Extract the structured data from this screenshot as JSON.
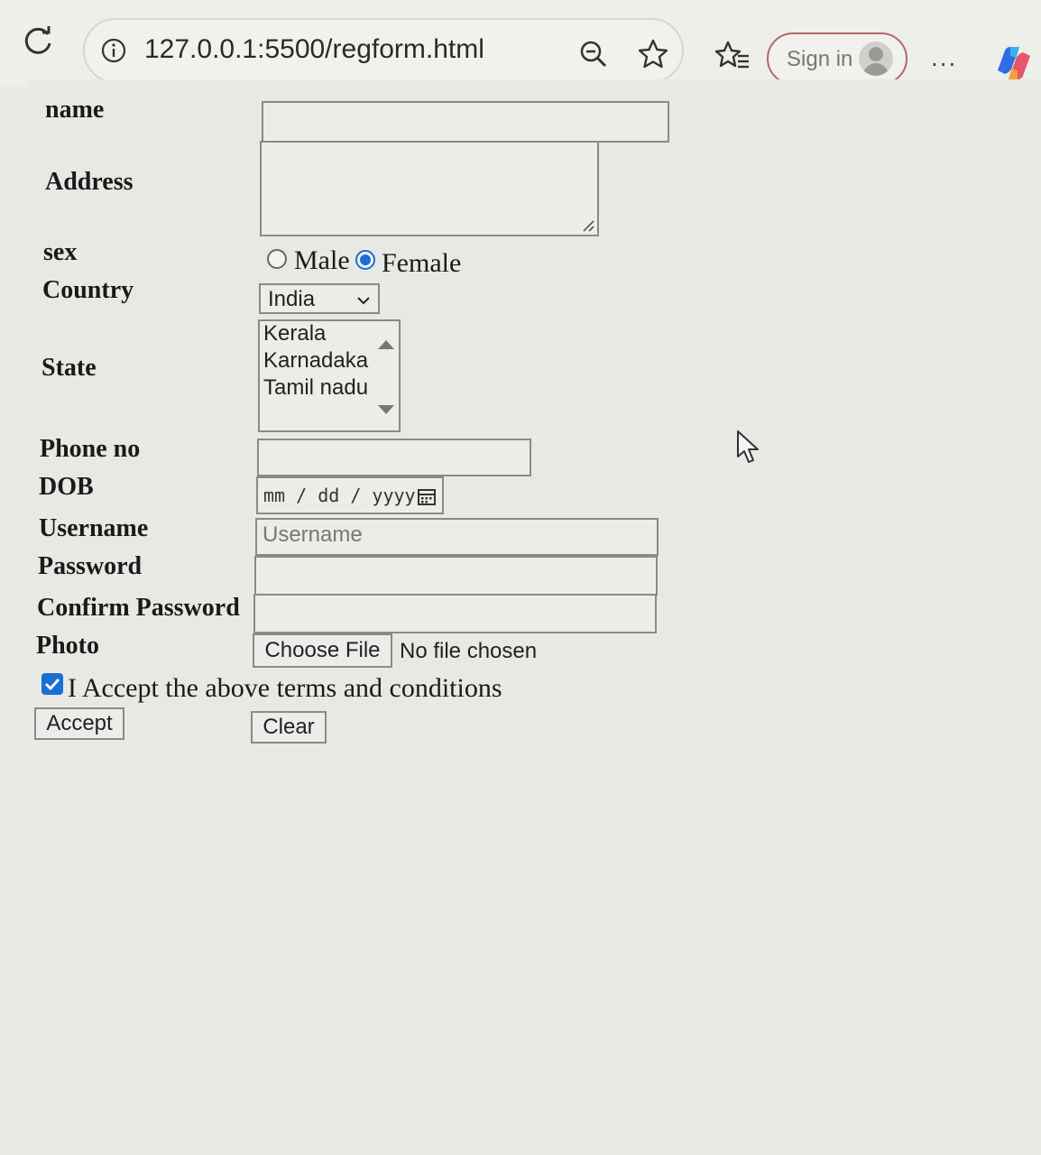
{
  "browser": {
    "url": "127.0.0.1:5500/regform.html",
    "signin_label": "Sign in",
    "more_label": "...",
    "icons": [
      "reload-icon",
      "info-icon",
      "zoom-out-icon",
      "favorite-star-icon",
      "favorites-list-icon",
      "avatar-icon",
      "copilot-icon"
    ]
  },
  "form": {
    "labels": {
      "name": "name",
      "address": "Address",
      "sex": "sex",
      "country": "Country",
      "state": "State",
      "phone": "Phone no",
      "dob": "DOB",
      "username": "Username",
      "password": "Password",
      "confirm_password": "Confirm Password",
      "photo": "Photo"
    },
    "sex_options": {
      "male": "Male",
      "female": "Female",
      "selected": "Female"
    },
    "country_selected": "India",
    "states": [
      "Kerala",
      "Karnadaka",
      "Tamil nadu"
    ],
    "dob_placeholder": "mm / dd / yyyy",
    "username_placeholder": "Username",
    "file_button": "Choose File",
    "file_status": "No file chosen",
    "terms_text": "I Accept the above terms and conditions",
    "terms_checked": true,
    "accept_button": "Accept",
    "clear_button": "Clear"
  },
  "colors": {
    "accent": "#1a6fd6",
    "signin_border": "#b06a6a"
  }
}
